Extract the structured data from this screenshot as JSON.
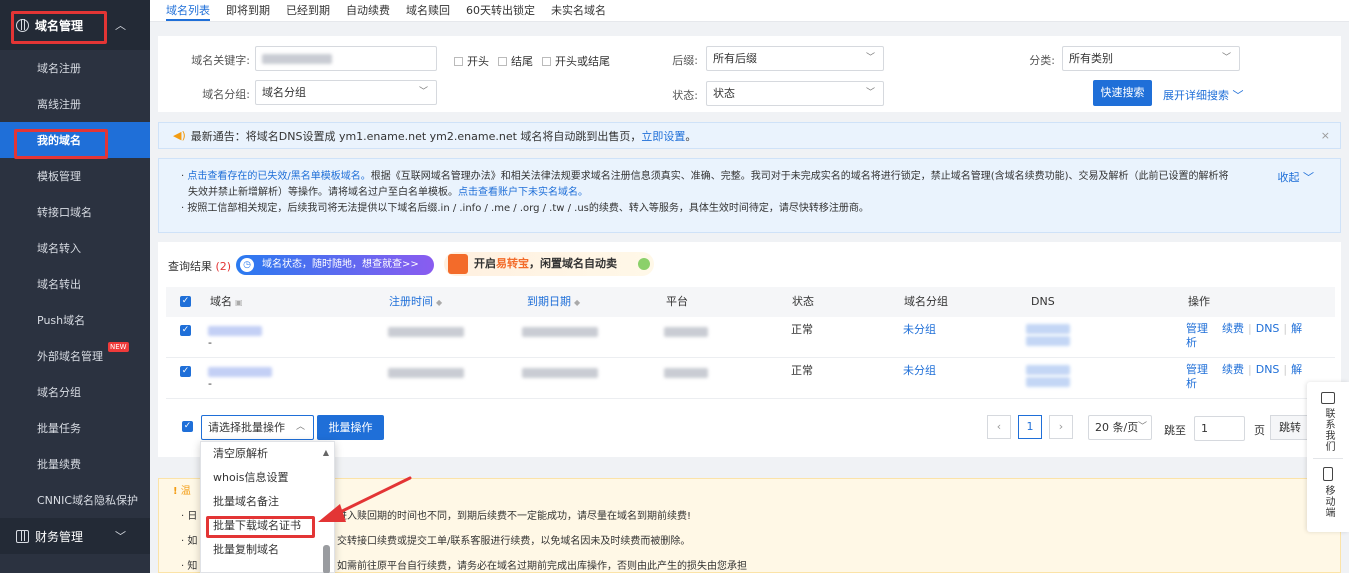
{
  "sidebar": {
    "group_main": "域名管理",
    "items": [
      {
        "label": "域名注册"
      },
      {
        "label": "离线注册"
      },
      {
        "label": "我的域名"
      },
      {
        "label": "模板管理"
      },
      {
        "label": "转接口域名"
      },
      {
        "label": "域名转入"
      },
      {
        "label": "域名转出"
      },
      {
        "label": "Push域名"
      },
      {
        "label": "外部域名管理",
        "badge": "NEW"
      },
      {
        "label": "域名分组"
      },
      {
        "label": "批量任务"
      },
      {
        "label": "批量续费"
      },
      {
        "label": "CNNIC域名隐私保护"
      }
    ],
    "group_finance": "财务管理"
  },
  "tabs": [
    "域名列表",
    "即将到期",
    "已经到期",
    "自动续费",
    "域名赎回",
    "60天转出锁定",
    "未实名域名"
  ],
  "search": {
    "keyword_label": "域名关键字:",
    "opt_start": "开头",
    "opt_end": "结尾",
    "opt_either": "开头或结尾",
    "suffix_label": "后缀:",
    "suffix_value": "所有后缀",
    "category_label": "分类:",
    "category_value": "所有类别",
    "group_label": "域名分组:",
    "group_value": "域名分组",
    "status_label": "状态:",
    "status_value": "状态",
    "quick_search": "快速搜索",
    "advanced": "展开详细搜索"
  },
  "notice": {
    "text": "最新通告：将域名DNS设置成 ym1.ename.net ym2.ename.net 域名将自动跳到出售页，",
    "link": "立即设置",
    "tail": "。",
    "close": "×"
  },
  "rules": {
    "line1_link": "点击查看存在的已失效/黑名单模板域名。",
    "line1_text": "根据《互联网域名管理办法》和相关法律法规要求域名注册信息须真实、准确、完整。我司对于未完成实名的域名将进行锁定，禁止域名管理(含域名续费功能)、交易及解析（此前已设置的解析将",
    "line2_text": "失效并禁止新增解析）等操作。请将域名过户至白名单模板。",
    "line2_link": "点击查看账户下未实名域名。",
    "line3_text": "按照工信部相关规定，后续我司将无法提供以下域名后缀.in / .info / .me / .org / .tw / .us的续费、转入等服务，具体生效时间待定，请尽快转移注册商。",
    "collapse": "收起"
  },
  "results": {
    "label": "查询结果",
    "count": "(2)",
    "promo_blue": "域名状态，随时随地，想查就查>>",
    "promo_orange_a": "开启",
    "promo_orange_b": "易转宝",
    "promo_orange_c": "，闲置域名自动卖",
    "columns": [
      "域名",
      "注册时间",
      "到期日期",
      "平台",
      "状态",
      "域名分组",
      "DNS",
      "操作"
    ],
    "rows": [
      {
        "sub": "-",
        "status": "正常",
        "group": "未分组"
      },
      {
        "sub": "-",
        "status": "正常",
        "group": "未分组"
      }
    ],
    "ops": {
      "manage": "管理",
      "manage2": "析",
      "renew": "续费",
      "dns": "DNS",
      "resolve": "解"
    }
  },
  "batch": {
    "select_value": "请选择批量操作",
    "button": "批量操作",
    "page_current": "1",
    "page_size": "20 条/页",
    "goto_label": "跳至",
    "goto_value": "1",
    "page_unit": "页",
    "goto_btn": "跳转"
  },
  "dropdown": {
    "items": [
      "清空原解析",
      "whois信息设置",
      "批量域名备注",
      "批量下载域名证书",
      "批量复制域名"
    ]
  },
  "warning": {
    "icon": "!",
    "title": "温",
    "line1_start": "· 日",
    "line1": "进入赎回期的时间也不同，到期后续费不一定能成功，请尽量在域名到期前续费!",
    "line2_start": "· 如",
    "line2": "交转接口续费或提交工单/联系客服进行续费，以免域名因未及时续费而被删除。",
    "line3_start": "· 知",
    "line3": "如需前往原平台自行续费，请务必在域名过期前完成出库操作，否则由此产生的损失由您承担"
  },
  "float": {
    "contact": "联系我们",
    "mobile": "移动端"
  },
  "colors": {
    "primary": "#1f6fd8",
    "highlight_red": "#e33535",
    "sidebar_bg": "#2b3240"
  }
}
